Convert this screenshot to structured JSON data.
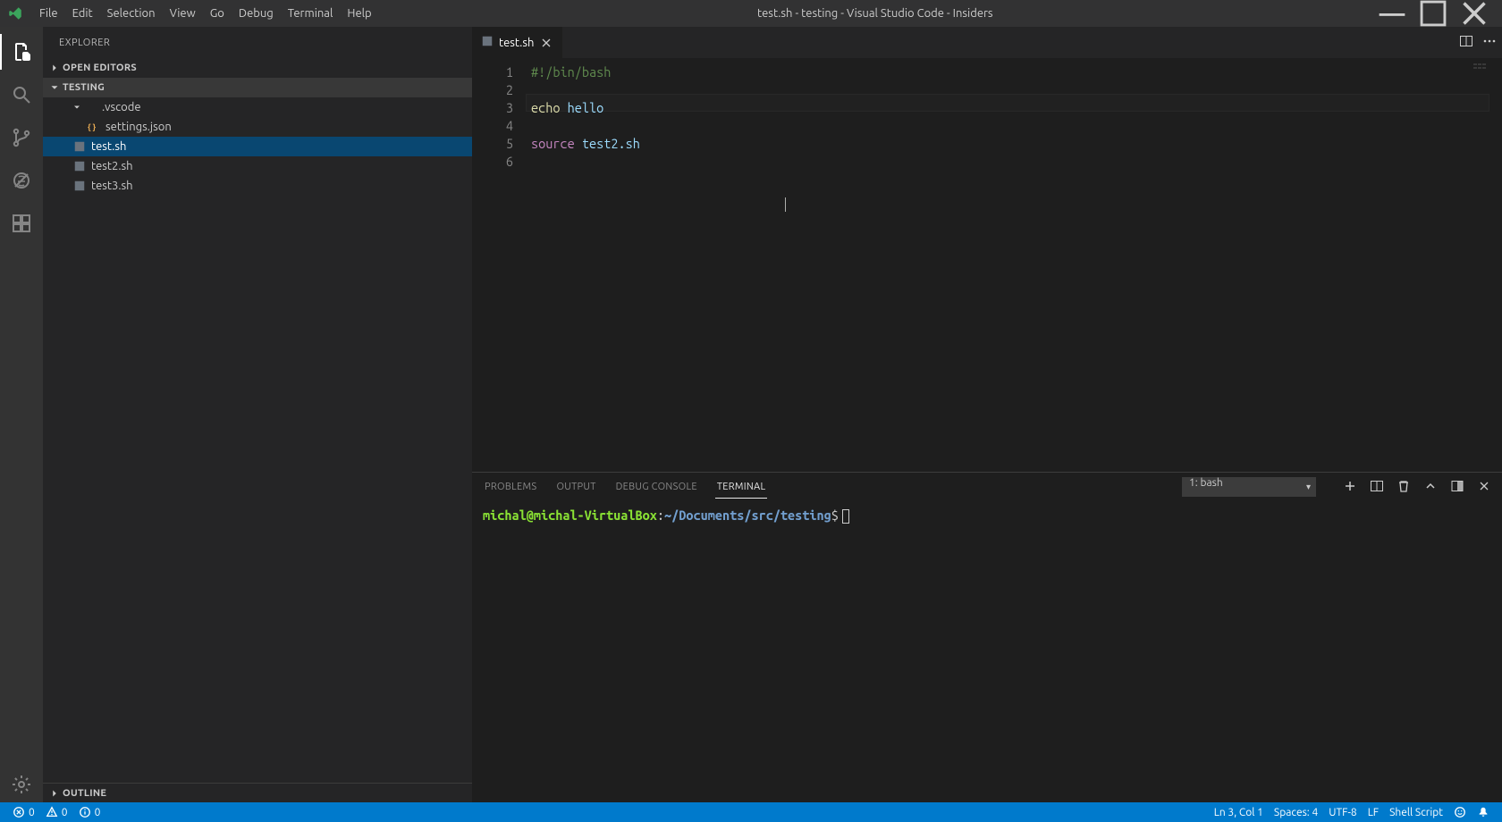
{
  "window": {
    "title": "test.sh - testing - Visual Studio Code - Insiders"
  },
  "menu": [
    "File",
    "Edit",
    "Selection",
    "View",
    "Go",
    "Debug",
    "Terminal",
    "Help"
  ],
  "sidebar": {
    "title": "EXPLORER",
    "sections": {
      "openEditors": "OPEN EDITORS",
      "folder": "TESTING",
      "outline": "OUTLINE"
    },
    "tree": [
      {
        "label": ".vscode",
        "type": "folder",
        "depth": 1,
        "expanded": true
      },
      {
        "label": "settings.json",
        "type": "json",
        "depth": 2
      },
      {
        "label": "test.sh",
        "type": "sh",
        "depth": 1,
        "selected": true
      },
      {
        "label": "test2.sh",
        "type": "sh",
        "depth": 1
      },
      {
        "label": "test3.sh",
        "type": "sh",
        "depth": 1
      }
    ]
  },
  "tabs": [
    {
      "label": "test.sh",
      "active": true
    }
  ],
  "code": {
    "lineNumbers": [
      "1",
      "2",
      "3",
      "4",
      "5",
      "6"
    ],
    "lines": [
      {
        "segments": [
          {
            "t": "#!/bin/bash",
            "c": "tok-cmt"
          }
        ]
      },
      {
        "segments": []
      },
      {
        "segments": [
          {
            "t": "echo",
            "c": "tok-fn"
          },
          {
            "t": " ",
            "c": "tok-plain"
          },
          {
            "t": "hello",
            "c": "tok-id"
          }
        ],
        "highlight": true
      },
      {
        "segments": []
      },
      {
        "segments": [
          {
            "t": "source",
            "c": "tok-kw"
          },
          {
            "t": " ",
            "c": "tok-plain"
          },
          {
            "t": "test2.sh",
            "c": "tok-id"
          }
        ]
      },
      {
        "segments": []
      }
    ]
  },
  "panel": {
    "tabs": [
      "PROBLEMS",
      "OUTPUT",
      "DEBUG CONSOLE",
      "TERMINAL"
    ],
    "activeTab": "TERMINAL",
    "terminalSelect": "1: bash",
    "prompt": {
      "user": "michal@michal-VirtualBox",
      "sep": ":",
      "path": "~/Documents/src/testing",
      "suffix": "$"
    }
  },
  "status": {
    "errors": "0",
    "warnings": "0",
    "info": "0",
    "cursor": "Ln 3, Col 1",
    "spaces": "Spaces: 4",
    "encoding": "UTF-8",
    "eol": "LF",
    "lang": "Shell Script"
  }
}
